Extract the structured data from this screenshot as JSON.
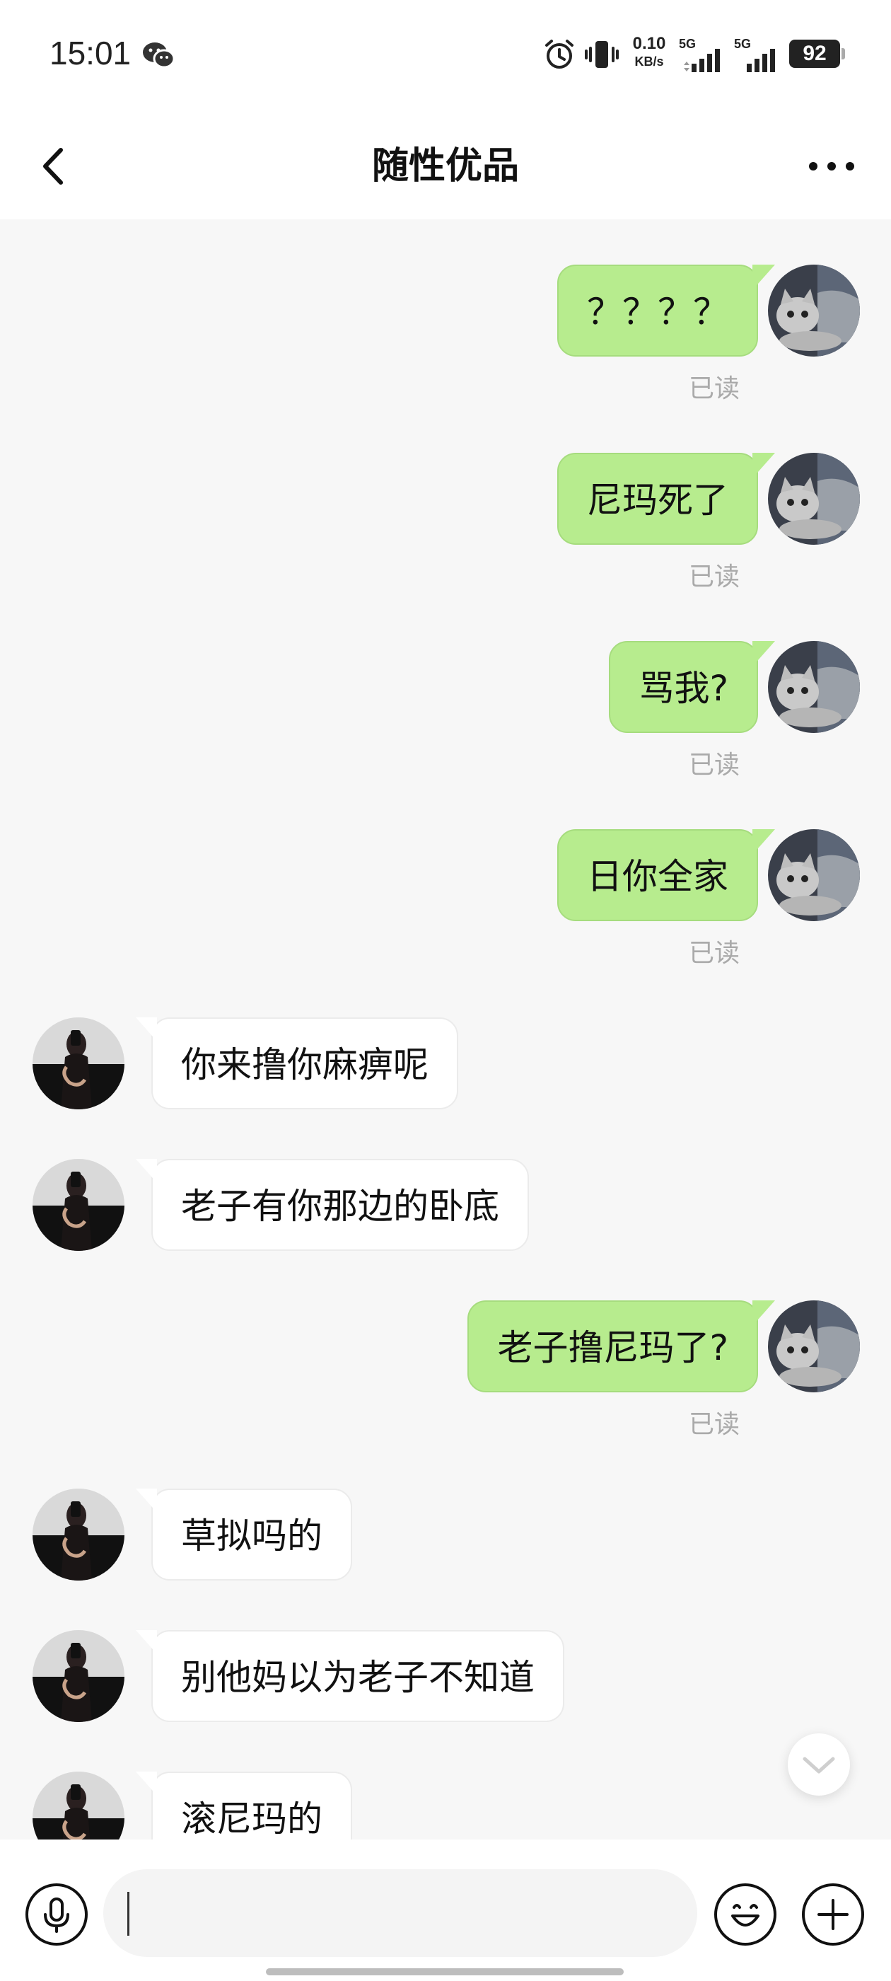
{
  "status_bar": {
    "time": "15:01",
    "net_speed_value": "0.10",
    "net_speed_unit": "KB/s",
    "sim1_label": "5G",
    "sim2_label": "5G",
    "battery": "92"
  },
  "header": {
    "title": "随性优品"
  },
  "messages": [
    {
      "sender": "me",
      "text": "？？？？",
      "receipt": "已读"
    },
    {
      "sender": "me",
      "text": "尼玛死了",
      "receipt": "已读"
    },
    {
      "sender": "me",
      "text": "骂我?",
      "receipt": "已读"
    },
    {
      "sender": "me",
      "text": "日你全家",
      "receipt": "已读"
    },
    {
      "sender": "them",
      "text": "你来撸你麻痹呢"
    },
    {
      "sender": "them",
      "text": "老子有你那边的卧底"
    },
    {
      "sender": "me",
      "text": "老子撸尼玛了?",
      "receipt": "已读"
    },
    {
      "sender": "them",
      "text": "草拟吗的"
    },
    {
      "sender": "them",
      "text": "别他妈以为老子不知道"
    },
    {
      "sender": "them",
      "text": "滚尼玛的"
    }
  ],
  "colors": {
    "my_bubble": "#b7ec8e",
    "their_bubble": "#ffffff",
    "background": "#f7f7f7"
  },
  "icons": {
    "back": "chevron-left-icon",
    "more": "more-dots-icon",
    "voice": "microphone-icon",
    "emoji": "emoji-icon",
    "plus": "plus-icon",
    "scroll": "chevron-down-icon"
  },
  "input": {
    "value": "",
    "placeholder": ""
  }
}
